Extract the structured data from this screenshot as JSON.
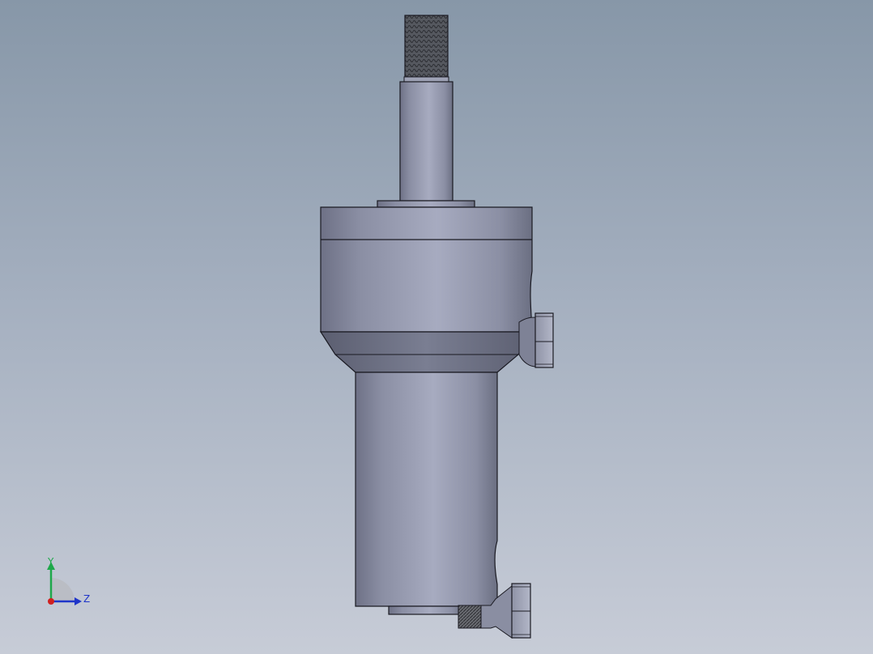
{
  "viewport": {
    "background_top": "#8797a8",
    "background_bottom": "#c7ccd7"
  },
  "model": {
    "body_color": "#9aa0b6",
    "edge_color": "#1a1a22"
  },
  "triad": {
    "y_label": "Y",
    "z_label": "Z",
    "y_color": "#1ea84a",
    "z_color": "#1f35c9",
    "x_color": "#d02020"
  }
}
